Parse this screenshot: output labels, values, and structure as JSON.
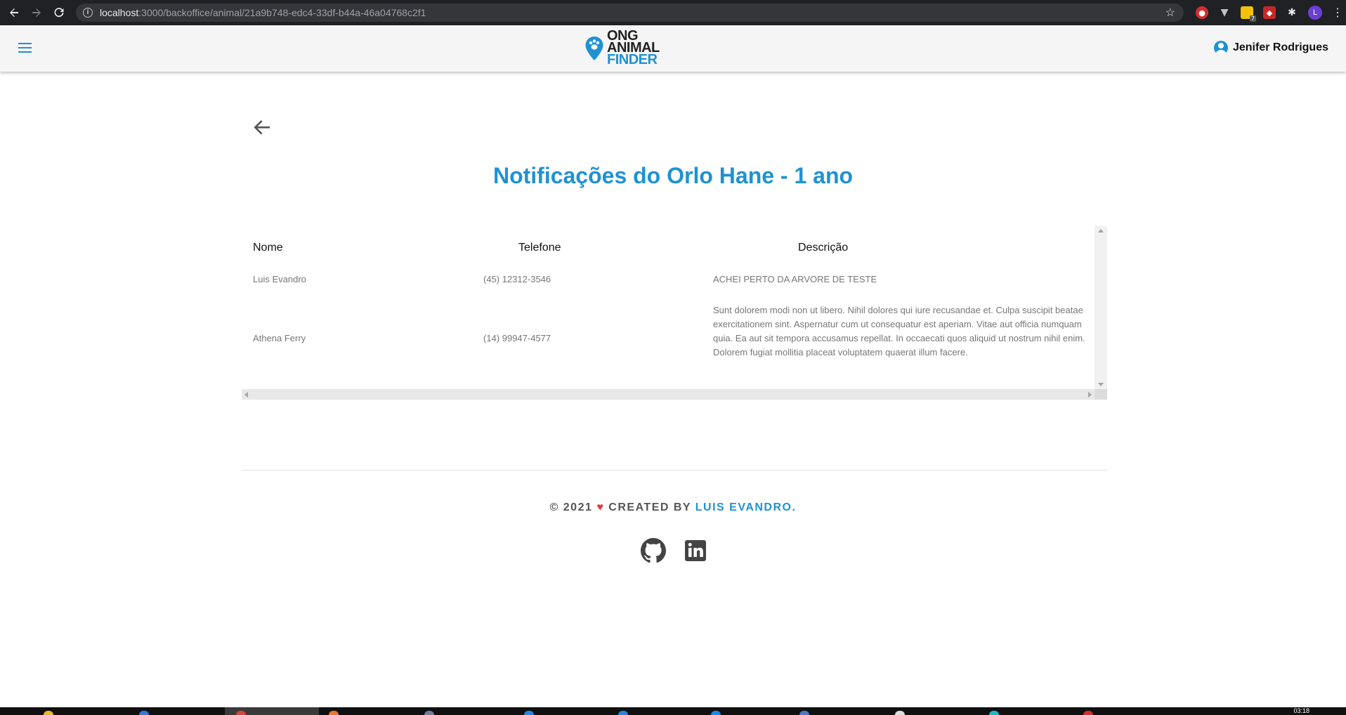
{
  "browser": {
    "url_host": "localhost",
    "url_path": ":3000/backoffice/animal/21a9b748-edc4-33df-b44a-46a04768c2f1",
    "profile_initial": "L",
    "ext_badge": "7"
  },
  "header": {
    "logo_line1": "ONG",
    "logo_line2": "ANIMAL",
    "logo_line3": "FINDER",
    "user_name": "Jenifer Rodrigues"
  },
  "page": {
    "title": "Notificações do Orlo Hane - 1 ano"
  },
  "table": {
    "columns": [
      "Nome",
      "Telefone",
      "Descrição"
    ],
    "rows": [
      {
        "nome": "Luis Evandro",
        "telefone": "(45) 12312-3546",
        "descricao": "ACHEI PERTO DA ARVORE DE TESTE"
      },
      {
        "nome": "Athena Ferry",
        "telefone": "(14) 99947-4577",
        "descricao": "Sunt dolorem modi non ut libero. Nihil dolores qui iure recusandae et. Culpa suscipit beatae exercitationem sint. Aspernatur cum ut consequatur est aperiam. Vitae aut officia numquam quia. Ea aut sit tempora accusamus repellat. In occaecati quos aliquid ut nostrum nihil enim. Dolorem fugiat mollitia placeat voluptatem quaerat illum facere."
      }
    ]
  },
  "footer": {
    "prefix": "© 2021",
    "heart": "♥",
    "created_by": "CREATED BY",
    "author": "LUIS EVANDRO",
    "suffix": "."
  },
  "taskbar": {
    "clock": "03:18"
  },
  "colors": {
    "brand": "#1f92d1",
    "heart": "#e53935"
  }
}
